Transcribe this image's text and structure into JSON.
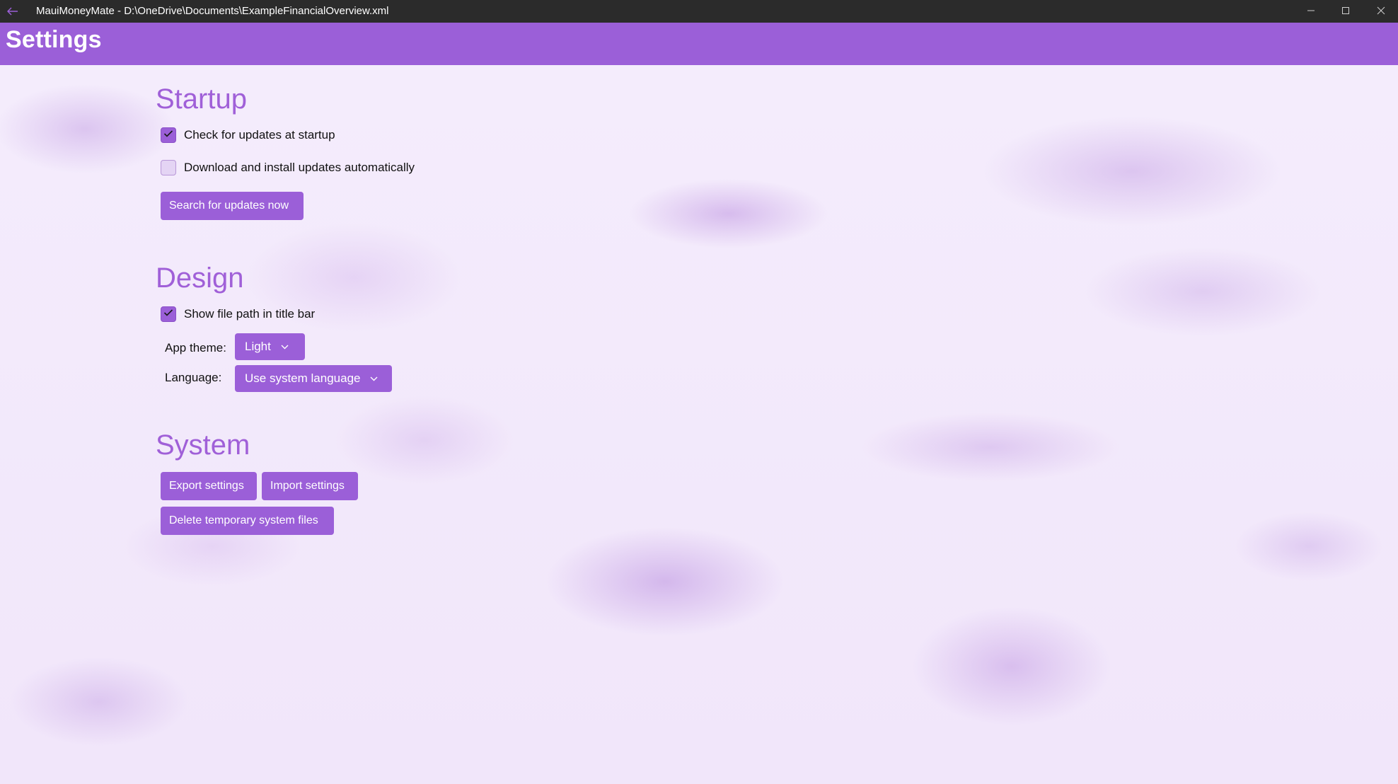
{
  "window": {
    "title": "MauiMoneyMate - D:\\OneDrive\\Documents\\ExampleFinancialOverview.xml",
    "back_icon": "back-arrow-icon",
    "controls": [
      "minimize-icon",
      "maximize-icon",
      "close-icon"
    ]
  },
  "header": {
    "title": "Settings"
  },
  "startup": {
    "title": "Startup",
    "check_updates": {
      "label": "Check for updates at startup",
      "checked": true
    },
    "auto_install": {
      "label": "Download and install updates automatically",
      "checked": false
    },
    "search_button": "Search for updates now"
  },
  "design": {
    "title": "Design",
    "show_path": {
      "label": "Show file path in title bar",
      "checked": true
    },
    "theme_label": "App theme:",
    "theme_value": "Light",
    "language_label": "Language:",
    "language_value": "Use system language"
  },
  "system": {
    "title": "System",
    "export_button": "Export settings",
    "import_button": "Import settings",
    "delete_button": "Delete temporary system files"
  },
  "colors": {
    "accent": "#9b5fd8",
    "section_title": "#a060d8",
    "titlebar": "#2b2b2b",
    "background": "#f3ebfb"
  }
}
